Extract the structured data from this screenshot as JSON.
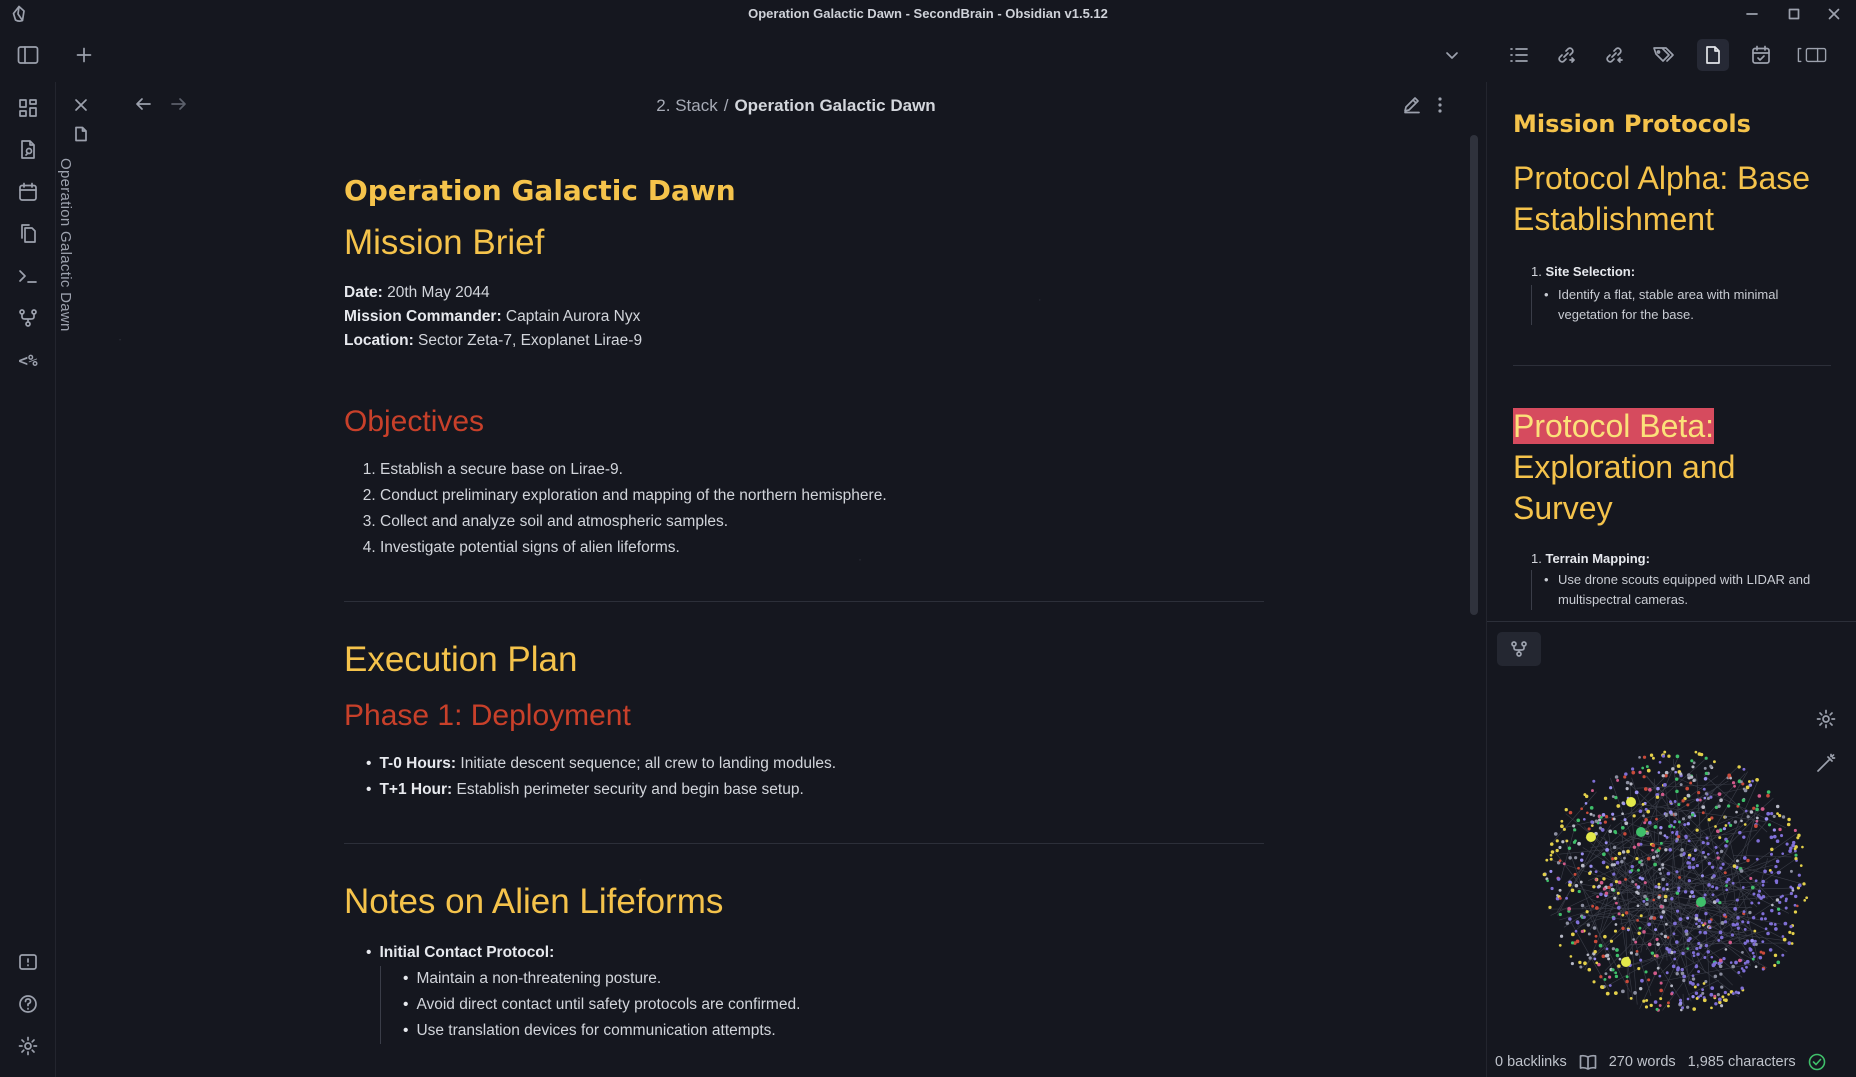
{
  "window": {
    "title": "Operation Galactic Dawn - SecondBrain - Obsidian v1.5.12"
  },
  "editor": {
    "breadcrumb_parent": "2. Stack",
    "breadcrumb_sep": "/",
    "breadcrumb_current": "Operation Galactic Dawn",
    "stack_spine_title": "Operation Galactic Dawn"
  },
  "note": {
    "inline_title": "Operation Galactic Dawn",
    "h1_brief": "Mission Brief",
    "meta": [
      {
        "label": "Date:",
        "value": " 20th May 2044"
      },
      {
        "label": "Mission Commander:",
        "value": " Captain Aurora Nyx"
      },
      {
        "label": "Location:",
        "value": " Sector Zeta-7, Exoplanet Lirae-9"
      }
    ],
    "h2_objectives": "Objectives",
    "objectives": [
      "Establish a secure base on Lirae-9.",
      "Conduct preliminary exploration and mapping of the northern hemisphere.",
      "Collect and analyze soil and atmospheric samples.",
      "Investigate potential signs of alien lifeforms."
    ],
    "h1_execution": "Execution Plan",
    "h2_phase1": "Phase 1: Deployment",
    "phase1": [
      {
        "label": "T-0 Hours:",
        "text": " Initiate descent sequence; all crew to landing modules."
      },
      {
        "label": "T+1 Hour:",
        "text": " Establish perimeter security and begin base setup."
      }
    ],
    "h1_lifeforms": "Notes on Alien Lifeforms",
    "lifeforms_label": "Initial Contact Protocol:",
    "lifeforms": [
      "Maintain a non-threatening posture.",
      "Avoid direct contact until safety protocols are confirmed.",
      "Use translation devices for communication attempts."
    ]
  },
  "sidebar_note": {
    "title": "Mission Protocols",
    "alpha_heading": "Protocol Alpha: Base Establishment",
    "alpha_item_num": "1.",
    "alpha_item_label": "Site Selection:",
    "alpha_item_detail": "Identify a flat, stable area with minimal vegetation for the base.",
    "beta_heading_highlight": "Protocol Beta:",
    "beta_heading_rest": "Exploration and Survey",
    "beta_item_num": "1.",
    "beta_item_label": "Terrain Mapping:",
    "beta_item_detail": "Use drone scouts equipped with LIDAR and multispectral cameras."
  },
  "status": {
    "backlinks": "0 backlinks",
    "words": "270 words",
    "characters": "1,985 characters"
  },
  "colors": {
    "background": "#15171f",
    "heading_yellow": "#f5c34b",
    "heading_red": "#c8402a",
    "highlight": "#d64b5e",
    "sync_ok": "#3fbf6a"
  }
}
